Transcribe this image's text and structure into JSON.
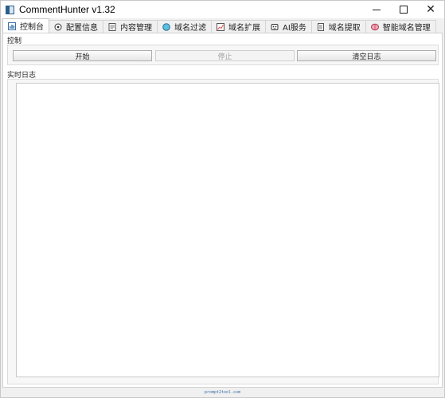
{
  "window": {
    "title": "CommentHunter v1.32",
    "controls": [
      "minimize-icon",
      "maximize-icon",
      "close-icon"
    ],
    "close_glyph": "✕"
  },
  "tabs": [
    {
      "label": "控制台",
      "icon": "dashboard-icon",
      "active": true
    },
    {
      "label": "配置信息",
      "icon": "gear-icon",
      "active": false
    },
    {
      "label": "内容管理",
      "icon": "document-icon",
      "active": false
    },
    {
      "label": "域名过滤",
      "icon": "globe-icon",
      "active": false
    },
    {
      "label": "域名扩展",
      "icon": "chart-icon",
      "active": false
    },
    {
      "label": "AI服务",
      "icon": "robot-icon",
      "active": false
    },
    {
      "label": "域名提取",
      "icon": "extract-icon",
      "active": false
    },
    {
      "label": "智能域名管理",
      "icon": "brain-icon",
      "active": false
    }
  ],
  "control_section": {
    "title": "控制",
    "start_label": "开始",
    "stop_label": "停止",
    "clear_label": "清空日志"
  },
  "log_section": {
    "title": "实时日志",
    "content": ""
  },
  "statusbar": {
    "text": "prompt2tool.com"
  },
  "colors": {
    "accent": "#3a6ea5",
    "disabled_text": "#a0a0a0"
  }
}
